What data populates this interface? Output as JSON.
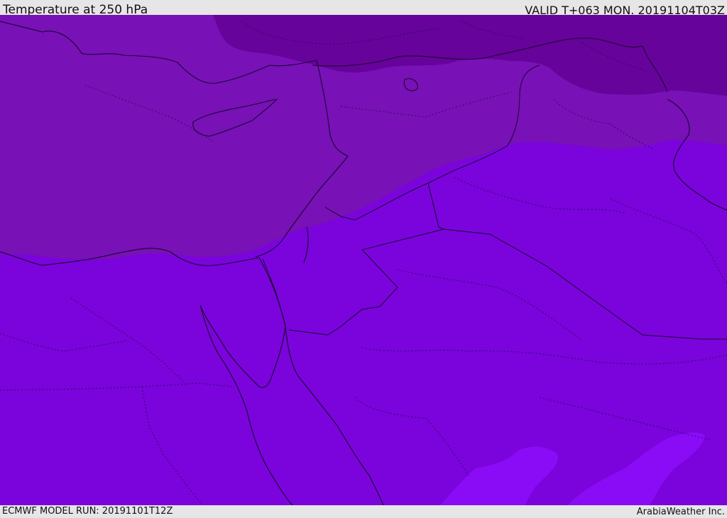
{
  "header": {
    "title": "Temperature at 250 hPa",
    "valid": "VALID T+063 MON. 20191104T03Z"
  },
  "footer": {
    "model_run": "ECMWF MODEL RUN: 20191101T12Z",
    "credit": "ArabiaWeather Inc."
  },
  "colors": {
    "band_coldest": "#66039a",
    "band_cold": "#7811b6",
    "band_mid": "#7a04db",
    "band_warm": "#8a0cf7",
    "coastline": "#1a0630",
    "border": "#1a0630"
  }
}
